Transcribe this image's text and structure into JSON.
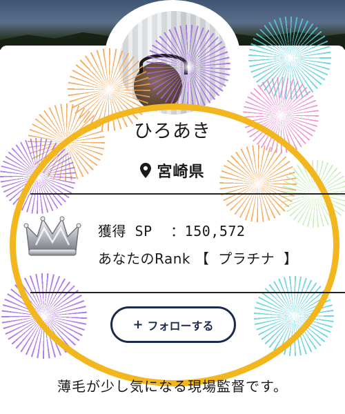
{
  "profile": {
    "name": "ひろあき",
    "location": "宮崎県",
    "sp_label": "獲得 SP",
    "sp_separator": "：",
    "sp_value": "150,572",
    "rank_label": "あなたのRank",
    "rank_open": "【",
    "rank_value": "プラチナ",
    "rank_close": "】",
    "follow_plus": "+",
    "follow_label": "フォローする",
    "bio": "薄毛が少し気になる現場監督です。"
  },
  "icons": {
    "location": "map-pin-icon",
    "rank": "crown-icon",
    "follow": "plus-icon"
  },
  "colors": {
    "highlight": "#f2b61e",
    "follow_border": "#1b2a4a",
    "divider": "#222222"
  }
}
